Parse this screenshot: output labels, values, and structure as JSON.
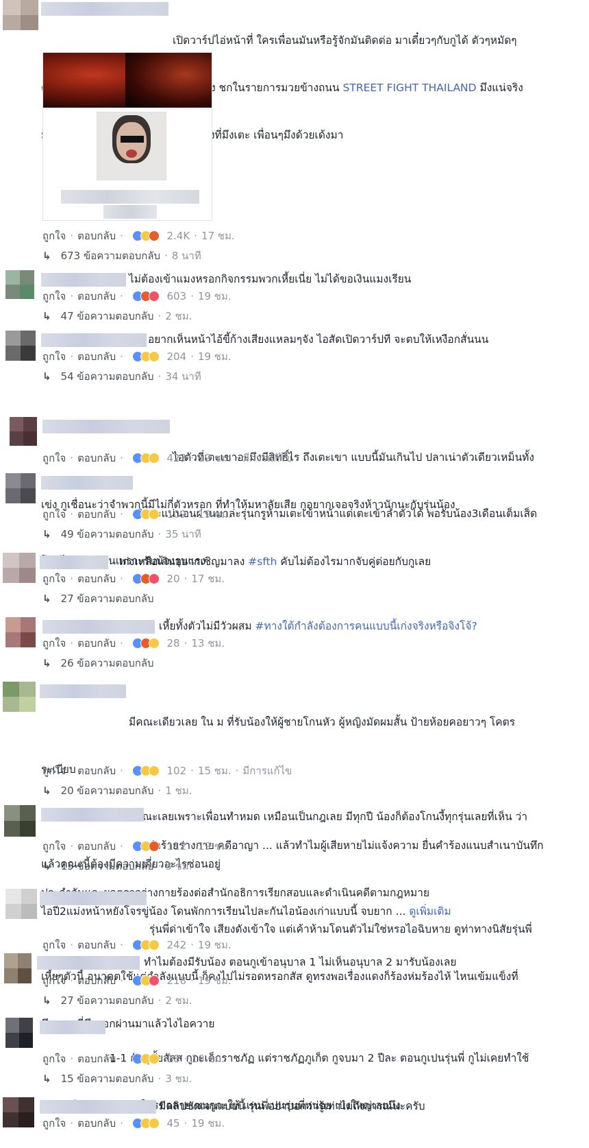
{
  "labels": {
    "like": "ถูกใจ",
    "reply": "ตอบกลับ",
    "sep": "·",
    "edited": "มีการแก้ไข",
    "see_more": "ดูเพิ่มเติม"
  },
  "comments": [
    {
      "text_lines": [
        "เปิดวาร์ปไอ่หน้าที่ ใครเพื่อนมันหรือรู้จักมันติดต่อ มาเดี๋ยวๆกับกูได้ ตัวๆหมัดๆ",
        "ต่อยในกรง 3 นาที กติกาทำได้ทุกอย่าง ชกในรายการมวยข้างถนน ",
        " มึงแน่จริง",
        "มึงมา ถ้ามึงแพ้มึงต้องยกมือไหว้รุ่นน้องที่มึงเตะ เพื่อนๆมึงด้วยเด้งมา"
      ],
      "link": "STREET FIGHT THAILAND",
      "count": "2.4K",
      "time": "17 ชม.",
      "replies": "673 ข้อความตอบกลับ",
      "reply_time": "8 นาที"
    },
    {
      "text": "ไม่ต้องเข้าแมงหรอกกิจกรรมพวกเหี้ยเนี่ย ไม่ได้ขอเงินแมงเรียน",
      "count": "603",
      "time": "19 ชม.",
      "replies": "47 ข้อความตอบกลับ",
      "reply_time": "2 ชม."
    },
    {
      "text": "อยากเห็นหน้าไอ้ขี้ก้างเสียงแหลมๆจัง ไอสัดเปิดวาร์ปที จะตบให้เหงือกสั่นนน",
      "count": "204",
      "time": "19 ชม.",
      "replies": "54 ข้อความตอบกลับ",
      "reply_time": "34 นาที"
    },
    {
      "text": "ไอตัวที่เตะเขาอะมึงมีสิทธิ์ไร ถึงเตะเขา แบบนี้มันเกินไป ปลาเน่าตัวเดียวเหม็นทั้ง",
      "text2": "เข่ง กูเชื่อนะว่าจำพวกนี้มีไม่กี่ตัวหรอก ที่ทำให้มหาลัยเสีย กูอยากเจอจริงห้าวนักนะกับรุ่นน้อง",
      "count": "423",
      "time": "19 ชม."
    },
    {
      "text": "วิศวะแน่นอนผ่านมาล่ะรุ่นกรูห้ามเตะเข้าหน้าแต่เตะเข้าลำตัวได้ พอรับน้อง3เดือนเต็มเส็ด",
      "text2": "โดนไร้ออก 5คนเพราะรับน้องรุนแรง",
      "count": "109",
      "time": "19 ชม.",
      "replies": "49 ข้อความตอบกลับ",
      "reply_time": "35 นาที"
    },
    {
      "text": "เก่งเหลือเกินอยากเชิญมาลง ",
      "tag": "#sfth",
      "text_after": " คับไม่ต้องไรมากจับคู่ต่อยกับกูเลย",
      "count": "20",
      "time": "17 ชม.",
      "replies": "27 ข้อความตอบกลับ"
    },
    {
      "text": "เหี้ยทั้งตัวไม่มีวัวผสม ",
      "tag": "#ทางใต้กำลังต้องการคนแบบนี้เก่งจริงหรือจิงโจ้?",
      "count": "28",
      "time": "13 ชม.",
      "replies": "26 ข้อความตอบกลับ"
    },
    {
      "text": "มีคณะเดียวเลย ใน ม ที่รับน้องให้ผู้ชายโกนหัว ผู้หญิงมัดผมสั้น ป้ายห้อยคอยาวๆ โคตร",
      "text2": "ระเบียบ",
      "text3": "ใครไม่ทำนี่กาฝากในคณะเลยเพราะเพื่อนทำหมด เหมือนเป็นกฎเลย มีทุกปี น้องก็ต้องโกนงี้ทุกรุ่นเลยที่เห็น ว่า",
      "text4": "แล้วคณะนี้ต้องมีความเกี่ยวอะไรซ่อนอยู่",
      "text5": "ไอปี2แม่งหน้าหยังโจรขู่น้อง โดนพักการเรียนไปละกันไอน้องเก่าแบบนี้ จบยาก ...",
      "count": "102",
      "time": "15 ชม.",
      "replies": "20 ข้อความตอบกลับ",
      "reply_time": "1 ชม."
    },
    {
      "text": "ทำร้ายร่างกาย คดีอาญา ... แล้วทำไมผู้เสียหายไม่แจ้งความ ยื่นคำร้องแนบสำเนาบันทึก",
      "text2": "ประจำวันและผลตรวจร่างกายร้องต่อสำนักอธิการเรียกสอบและดำเนินคดีตามกฎหมาย",
      "count": "112",
      "time": "19 ชม.",
      "replies": "15 ข้อความตอบกลับ",
      "reply_time": "3 ชม."
    },
    {
      "text": "รุ่นพี่ด่าเข้าใจ เสียงดังเข้าใจ แต่เค้าห้ามโดนตัวไม่ใช่หรอไอฉิบหาย ดูท่าทางนิสัยรุ่นพี่",
      "text2": "เหี้ยๆตัวนี้ อนาคตใช้แต่กำลังแบบนี้ ก็คงไปไม่รอดหรอกสัส ดูทรงพอเรื่องแดงก็ร้องห่มร้องไห้ ไหนเข้มแข็งที่",
      "text3": "มึงสอน ที่มึงบอกผ่านมาแล้วไงไอควาย",
      "count": "242",
      "time": "19 ชม."
    },
    {
      "text": "ทำไมต้องมีรับน้อง ตอนกูเข้าอนุบาล 1 ไม่เห็นอนุบาล 2 มารับน้องเลย",
      "count": "218",
      "time": "19 ชม.",
      "replies": "27 ข้อความตอบกลับ",
      "reply_time": "2 ชม."
    },
    {
      "text": "1-1 กับกูมั้ยสัสส กูกะเด็กราชภัฏ แต่ราชภัฏภูเก็ต กูจบมา 2 ปีละ ตอนกูเปนรุ่นพี่ กูไม่เคยทำใช้",
      "text2": "อารมณ์กับรุ่นน้องเลย ใครขอลายเซนกูกะให้ แหม่ เปนรุ่นพี่หน่อย เบ่งใหญ่เลยมึง",
      "count": "18",
      "time": "16 ชม.",
      "replies": "15 ข้อความตอบกลับ",
      "reply_time": "3 ชม."
    },
    {
      "text": "มีคลิปชัดเจนแบบนี้ รุ่นพี่อย่าบอกว่ารู้เท่าไม่ถึงการณ์นะครับ",
      "count": "45",
      "time": "19 ชม."
    }
  ],
  "colors": {
    "link": "#4267b2",
    "meta": "#90949c",
    "action": "#4b4f56",
    "like_badge": "#5890ff"
  }
}
